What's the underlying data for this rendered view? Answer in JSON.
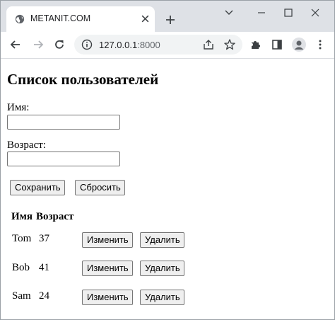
{
  "browser": {
    "tab_title": "METANIT.COM",
    "url_host": "127.0.0.1",
    "url_port": ":8000"
  },
  "page": {
    "heading": "Список пользователей",
    "form": {
      "name_label": "Имя:",
      "name_value": "",
      "age_label": "Возраст:",
      "age_value": "",
      "save_label": "Сохранить",
      "reset_label": "Сбросить"
    },
    "table": {
      "headers": [
        "Имя",
        "Возраст"
      ],
      "rows": [
        {
          "name": "Tom",
          "age": "37",
          "edit": "Изменить",
          "delete": "Удалить"
        },
        {
          "name": "Bob",
          "age": "41",
          "edit": "Изменить",
          "delete": "Удалить"
        },
        {
          "name": "Sam",
          "age": "24",
          "edit": "Изменить",
          "delete": "Удалить"
        }
      ]
    }
  },
  "colors": {
    "tabstrip": "#dee1e6",
    "omnibox": "#f1f3f4",
    "button_bg": "#efefef",
    "icon": "#5f6368"
  }
}
